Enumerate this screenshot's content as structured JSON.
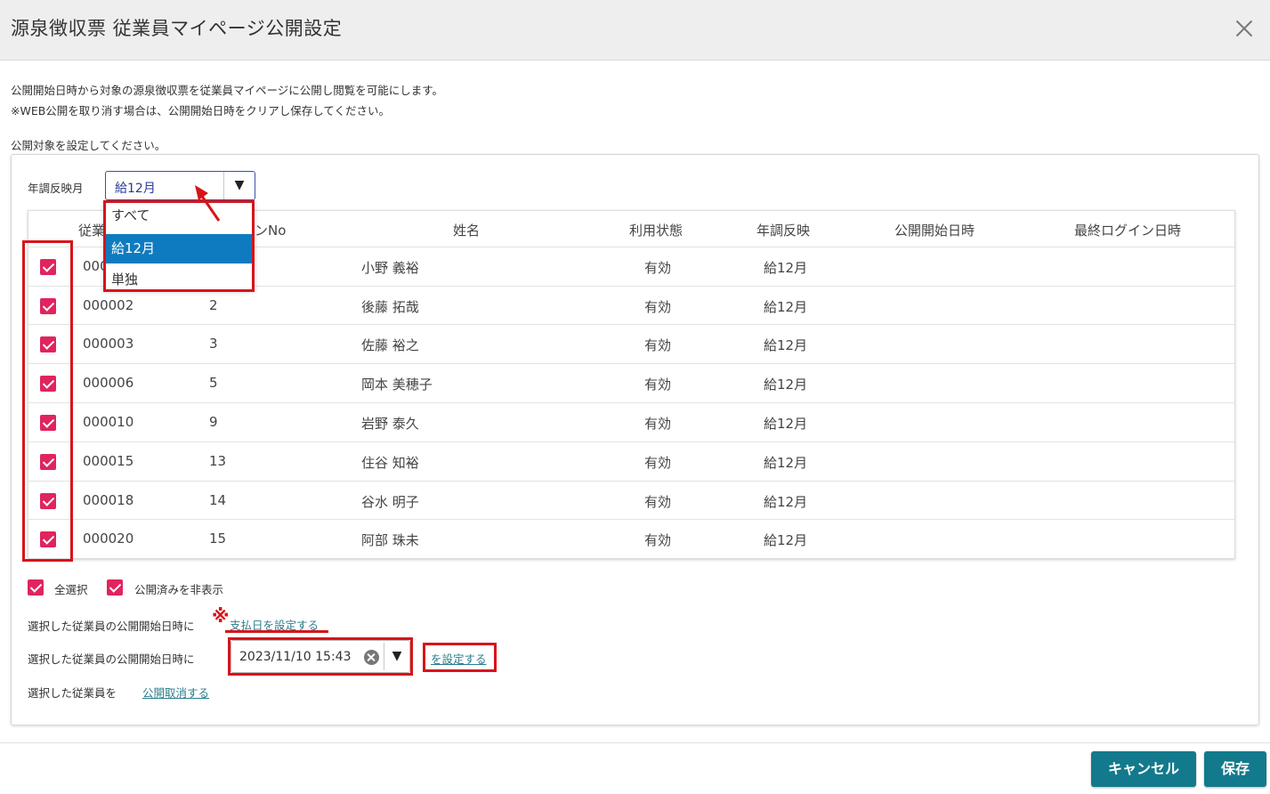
{
  "dialog": {
    "title": "源泉徴収票 従業員マイページ公開設定",
    "desc1": "公開開始日時から対象の源泉徴収票を従業員マイページに公開し閲覧を可能にします。",
    "desc2": "※WEB公開を取り消す場合は、公開開始日時をクリアし保存してください。",
    "desc3": "公開対象を設定してください。"
  },
  "filter": {
    "label": "年調反映月",
    "value": "給12月",
    "options": [
      "すべて",
      "給12月",
      "単独"
    ]
  },
  "table": {
    "headers": [
      "従業",
      "ンNo",
      "姓名",
      "利用状態",
      "年調反映",
      "公開開始日時",
      "最終ログイン日時"
    ],
    "rows": [
      {
        "code": "000",
        "no": "",
        "name": "小野 義裕",
        "status": "有効",
        "nencho": "給12月"
      },
      {
        "code": "000002",
        "no": "2",
        "name": "後藤 拓哉",
        "status": "有効",
        "nencho": "給12月"
      },
      {
        "code": "000003",
        "no": "3",
        "name": "佐藤 裕之",
        "status": "有効",
        "nencho": "給12月"
      },
      {
        "code": "000006",
        "no": "5",
        "name": "岡本 美穂子",
        "status": "有効",
        "nencho": "給12月"
      },
      {
        "code": "000010",
        "no": "9",
        "name": "岩野 泰久",
        "status": "有効",
        "nencho": "給12月"
      },
      {
        "code": "000015",
        "no": "13",
        "name": "住谷 知裕",
        "status": "有効",
        "nencho": "給12月"
      },
      {
        "code": "000018",
        "no": "14",
        "name": "谷水 明子",
        "status": "有効",
        "nencho": "給12月"
      },
      {
        "code": "000020",
        "no": "15",
        "name": "阿部 珠未",
        "status": "有効",
        "nencho": "給12月"
      }
    ]
  },
  "bulk": {
    "select_all": "全選択",
    "hide_published": "公開済みを非表示",
    "line1_label": "選択した従業員の公開開始日時に",
    "line1_link": "支払日を設定する",
    "line2_label": "選択した従業員の公開開始日時に",
    "date_value": "2023/11/10 15:43",
    "line2_link": "を設定する",
    "line3_label": "選択した従業員を",
    "line3_link": "公開取消する"
  },
  "annotation": {
    "mark": "※"
  },
  "footer": {
    "cancel": "キャンセル",
    "save": "保存"
  },
  "colors": {
    "accent": "#127a8c",
    "checkbox": "#e0245e",
    "highlight": "#d7141a",
    "selected_option": "#0e7bc0"
  }
}
